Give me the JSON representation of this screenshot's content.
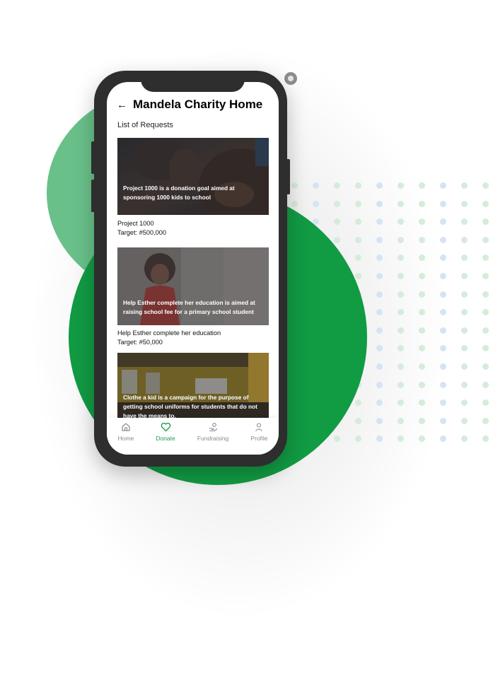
{
  "app": {
    "title": "Mandela Charity Home",
    "back_icon": "arrow-left-icon",
    "section_title": "List of Requests"
  },
  "requests": [
    {
      "caption": "Project 1000 is a donation goal aimed at sponsoring 1000 kids to school",
      "name": "Project 1000",
      "target": "Target: #500,000"
    },
    {
      "caption": "Help Esther complete her education is aimed at raising school fee for a primary school student",
      "name": "Help Esther complete her education",
      "target": "Target: #50,000"
    },
    {
      "caption": "Clothe a kid is a campaign for the purpose of getting school uniforms for students that do not have the means to."
    }
  ],
  "tabs": [
    {
      "label": "Home",
      "icon": "home-icon"
    },
    {
      "label": "Donate",
      "icon": "heart-icon",
      "active": true
    },
    {
      "label": "Fundraising",
      "icon": "hand-coins-icon"
    },
    {
      "label": "Profile",
      "icon": "user-icon"
    }
  ],
  "colors": {
    "accent": "#1aa14b",
    "circle_dark": "#119b43",
    "circle_light": "#69c089",
    "phone_frame": "#2e2e2e"
  }
}
